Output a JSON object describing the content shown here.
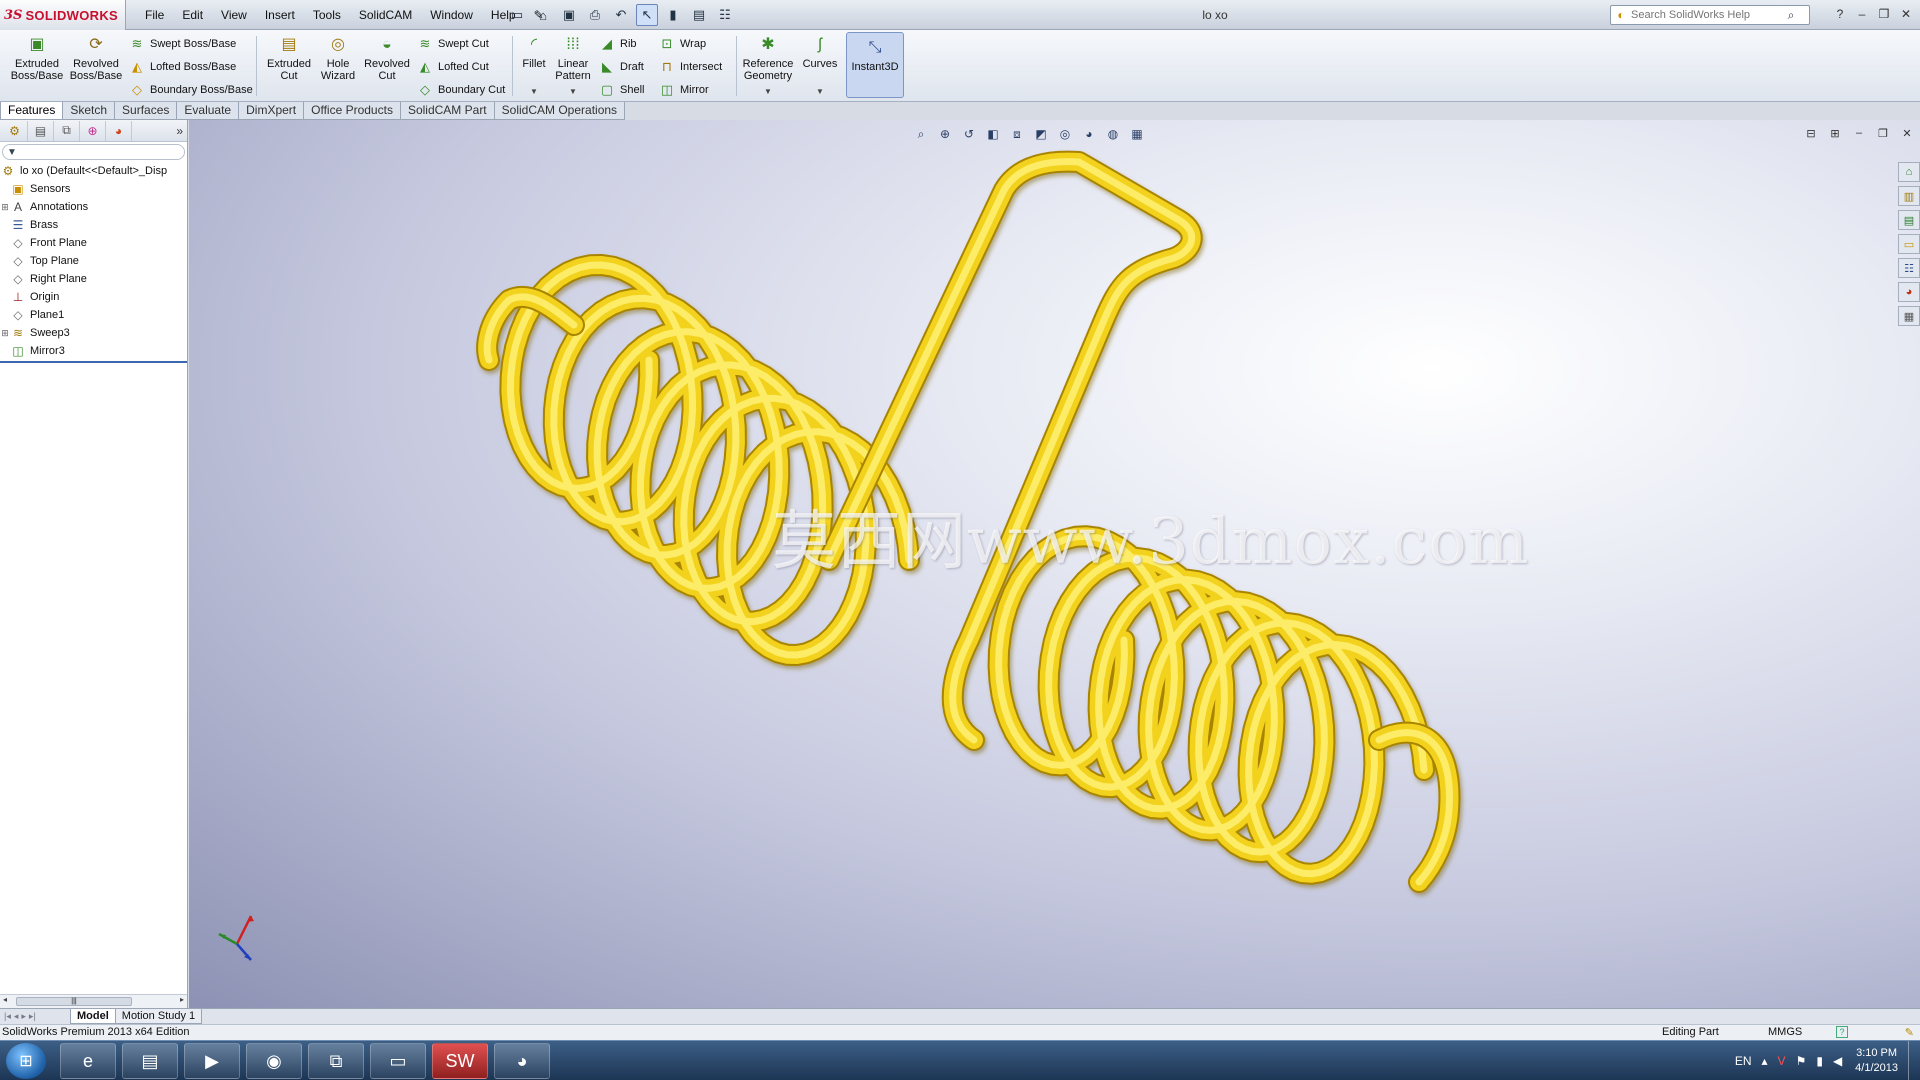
{
  "app": {
    "logo_ds": "3S",
    "logo_name": "SOLIDWORKS",
    "doc_title": "lo xo",
    "menus": [
      "File",
      "Edit",
      "View",
      "Insert",
      "Tools",
      "SolidCAM",
      "Window",
      "Help"
    ],
    "search_placeholder": "Search SolidWorks Help"
  },
  "commands": {
    "extruded_boss": "Extruded Boss/Base",
    "revolved_boss": "Revolved Boss/Base",
    "swept_boss": "Swept Boss/Base",
    "lofted_boss": "Lofted Boss/Base",
    "boundary_boss": "Boundary Boss/Base",
    "extruded_cut": "Extruded Cut",
    "hole_wizard": "Hole Wizard",
    "revolved_cut": "Revolved Cut",
    "swept_cut": "Swept Cut",
    "lofted_cut": "Lofted Cut",
    "boundary_cut": "Boundary Cut",
    "fillet": "Fillet",
    "linear_pattern": "Linear Pattern",
    "rib": "Rib",
    "draft": "Draft",
    "shell": "Shell",
    "wrap": "Wrap",
    "intersect": "Intersect",
    "mirror": "Mirror",
    "reference_geometry": "Reference Geometry",
    "curves": "Curves",
    "instant3d": "Instant3D"
  },
  "tabs": [
    "Features",
    "Sketch",
    "Surfaces",
    "Evaluate",
    "DimXpert",
    "Office Products",
    "SolidCAM Part",
    "SolidCAM Operations"
  ],
  "tree": {
    "root": "lo xo  (Default<<Default>_Disp",
    "items": [
      "Sensors",
      "Annotations",
      "Brass",
      "Front Plane",
      "Top Plane",
      "Right Plane",
      "Origin",
      "Plane1",
      "Sweep3",
      "Mirror3"
    ]
  },
  "viewport": {
    "watermark": "莫西网www.3dmox.com",
    "model_color": "#f2d21a"
  },
  "bottom_tabs": [
    "Model",
    "Motion Study 1"
  ],
  "status": {
    "edition": "SolidWorks Premium 2013 x64 Edition",
    "editing": "Editing Part",
    "units": "MMGS",
    "help": "?"
  },
  "taskbar": {
    "language": "EN",
    "time": "3:10 PM",
    "date": "4/1/2013"
  }
}
